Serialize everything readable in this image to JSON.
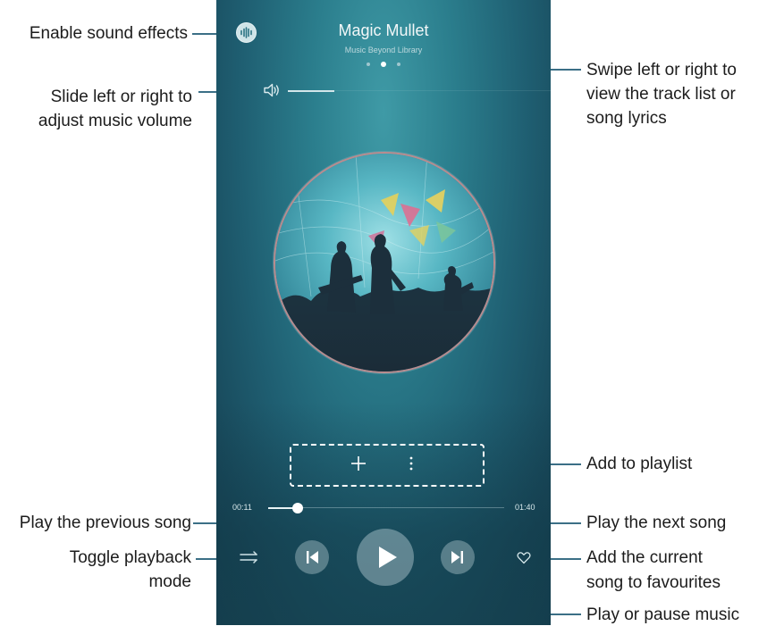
{
  "player": {
    "title": "Magic Mullet",
    "subtitle": "Music Beyond Library",
    "elapsed": "00:11",
    "duration": "01:40",
    "volume_level": 0.2,
    "progress": 0.11
  },
  "callouts": {
    "sound_effects": "Enable sound effects",
    "volume_1": "Slide left or right to",
    "volume_2": "adjust music volume",
    "swipe_1": "Swipe left or right to",
    "swipe_2": "view the track list or",
    "swipe_3": "song lyrics",
    "add_playlist": "Add to playlist",
    "prev_song": "Play the previous song",
    "next_song": "Play the next song",
    "toggle_1": "Toggle playback",
    "toggle_2": "mode",
    "fav_1": "Add the current",
    "fav_2": "song to favourites",
    "play_pause": "Play or pause music"
  },
  "colors": {
    "callout_line": "#3b6f86",
    "background_teal": "#2b7e8d"
  },
  "icons": [
    "sound-effects-icon",
    "volume-icon",
    "add-icon",
    "more-icon",
    "playback-mode-icon",
    "previous-icon",
    "play-icon",
    "next-icon",
    "heart-icon"
  ]
}
